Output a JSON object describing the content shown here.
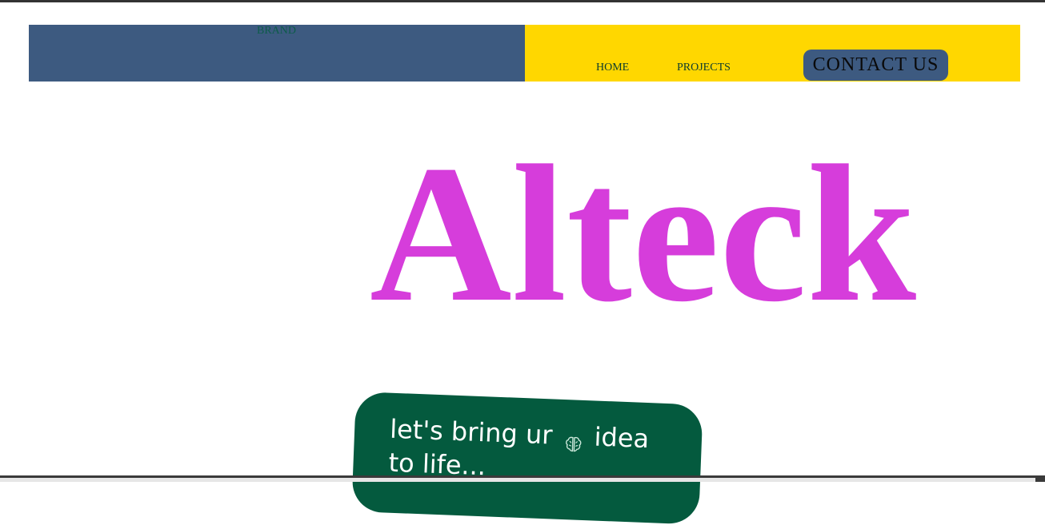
{
  "header": {
    "brand": "BRAND",
    "nav": {
      "home": "HOME",
      "projects": "PROJECTS",
      "contact": "CONTACT US"
    }
  },
  "hero": {
    "title": "Alteck",
    "tagline_before": "let's bring ur",
    "tagline_icon": "brain-icon",
    "tagline_after": "idea to life..."
  },
  "colors": {
    "nav_left_bg": "#3d5a80",
    "nav_right_bg": "#ffd700",
    "title_color": "#d63ddb",
    "tagline_bg": "#045a3e"
  }
}
